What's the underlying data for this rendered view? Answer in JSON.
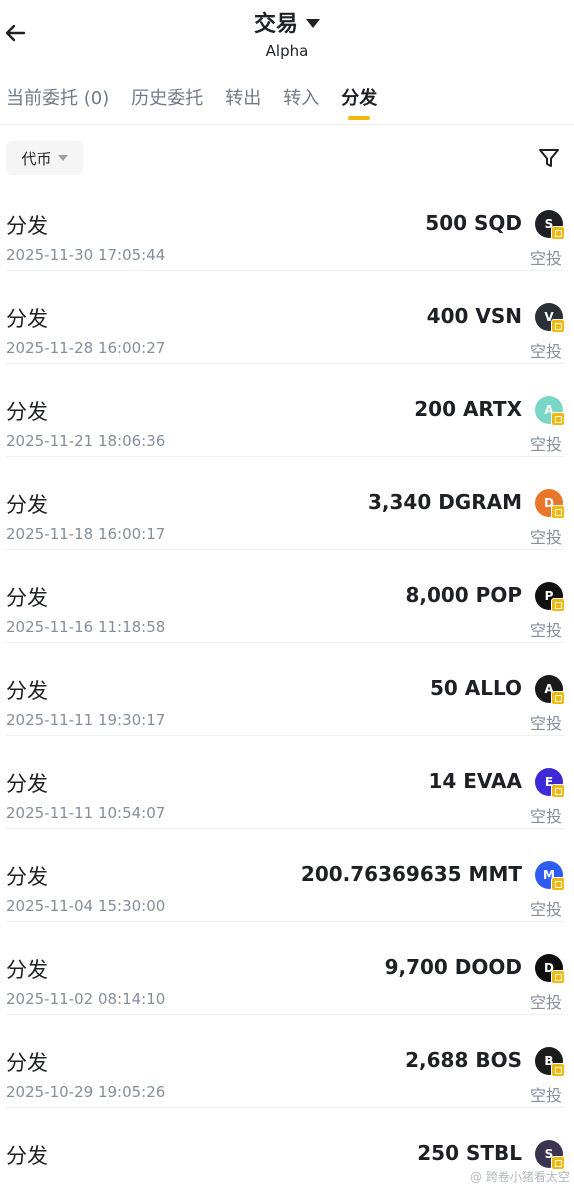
{
  "header": {
    "title": "交易",
    "subtitle": "Alpha"
  },
  "tabs": [
    {
      "label": "当前委托 (0)",
      "active": false
    },
    {
      "label": "历史委托",
      "active": false
    },
    {
      "label": "转出",
      "active": false
    },
    {
      "label": "转入",
      "active": false
    },
    {
      "label": "分发",
      "active": true
    }
  ],
  "filter": {
    "label": "代币"
  },
  "records": [
    {
      "title": "分发",
      "time": "2025-11-30 17:05:44",
      "amount": "500 SQD",
      "type": "空投",
      "icon": "sqd-token-icon",
      "color": "#1e2026",
      "glyph": "S"
    },
    {
      "title": "分发",
      "time": "2025-11-28 16:00:27",
      "amount": "400 VSN",
      "type": "空投",
      "icon": "vsn-token-icon",
      "color": "#2b2f36",
      "glyph": "V"
    },
    {
      "title": "分发",
      "time": "2025-11-21 18:06:36",
      "amount": "200 ARTX",
      "type": "空投",
      "icon": "artx-token-icon",
      "color": "#7ad7c5",
      "glyph": "A"
    },
    {
      "title": "分发",
      "time": "2025-11-18 16:00:17",
      "amount": "3,340 DGRAM",
      "type": "空投",
      "icon": "dgram-token-icon",
      "color": "#e8762b",
      "glyph": "D"
    },
    {
      "title": "分发",
      "time": "2025-11-16 11:18:58",
      "amount": "8,000 POP",
      "type": "空投",
      "icon": "pop-token-icon",
      "color": "#111111",
      "glyph": "P"
    },
    {
      "title": "分发",
      "time": "2025-11-11 19:30:17",
      "amount": "50 ALLO",
      "type": "空投",
      "icon": "allo-token-icon",
      "color": "#1a1a1a",
      "glyph": "A"
    },
    {
      "title": "分发",
      "time": "2025-11-11 10:54:07",
      "amount": "14 EVAA",
      "type": "空投",
      "icon": "evaa-token-icon",
      "color": "#3d2ad6",
      "glyph": "E"
    },
    {
      "title": "分发",
      "time": "2025-11-04 15:30:00",
      "amount": "200.76369635 MMT",
      "type": "空投",
      "icon": "mmt-token-icon",
      "color": "#2f5cf0",
      "glyph": "M"
    },
    {
      "title": "分发",
      "time": "2025-11-02 08:14:10",
      "amount": "9,700 DOOD",
      "type": "空投",
      "icon": "dood-token-icon",
      "color": "#0f0f0f",
      "glyph": "D"
    },
    {
      "title": "分发",
      "time": "2025-10-29 19:05:26",
      "amount": "2,688 BOS",
      "type": "空投",
      "icon": "bos-token-icon",
      "color": "#1c1c1c",
      "glyph": "B"
    },
    {
      "title": "分发",
      "time": "",
      "amount": "250 STBL",
      "type": "",
      "icon": "stbl-token-icon",
      "color": "#3a3450",
      "glyph": "S"
    }
  ],
  "watermark": "@ 跨卷小猪看太空",
  "colors": {
    "accent": "#f0b90b",
    "text_primary": "#1e2026",
    "text_secondary": "#848e9c"
  }
}
